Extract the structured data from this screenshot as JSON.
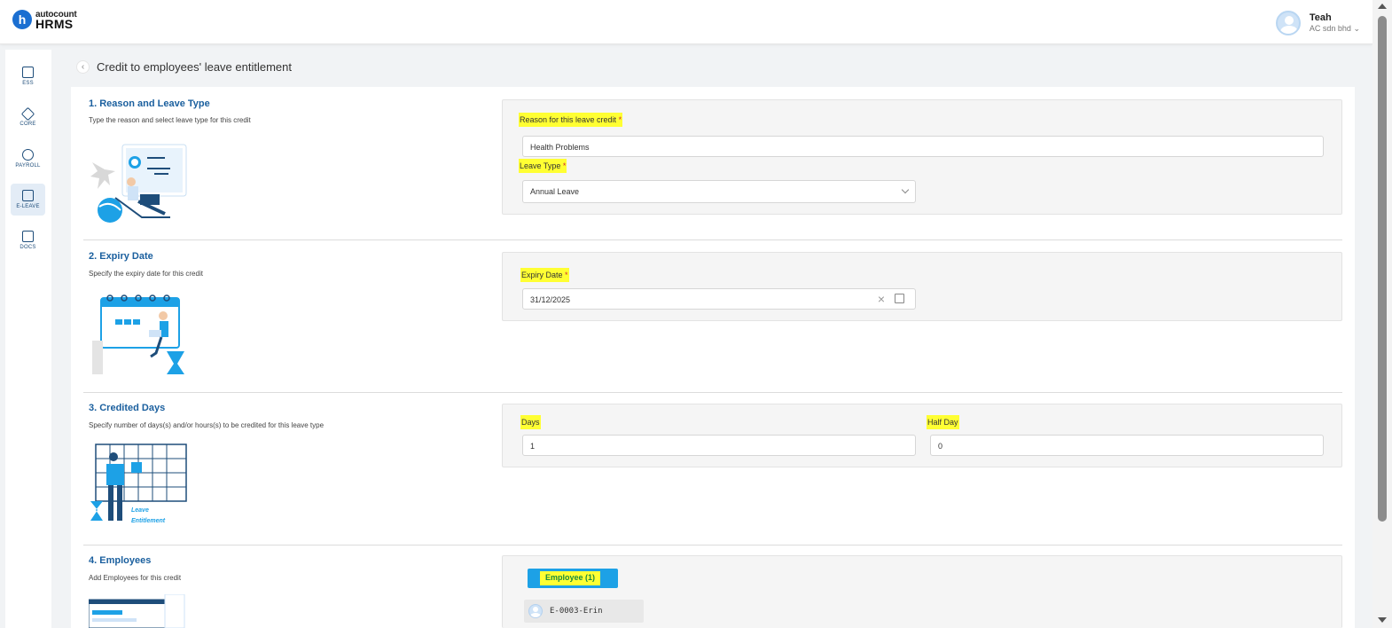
{
  "app": {
    "logo_small": "autocount",
    "logo_big": "HRMS",
    "logo_letter": "h"
  },
  "user": {
    "name": "Teah",
    "company": "AC sdn bhd"
  },
  "sidebar": {
    "items": [
      {
        "label": "ESS",
        "icon": "ess-icon"
      },
      {
        "label": "CORE",
        "icon": "core-icon"
      },
      {
        "label": "PAYROLL",
        "icon": "payroll-icon"
      },
      {
        "label": "E-LEAVE",
        "icon": "e-leave-icon",
        "active": true
      },
      {
        "label": "DOCS",
        "icon": "docs-icon"
      }
    ]
  },
  "page": {
    "title": "Credit to employees' leave entitlement"
  },
  "sections": {
    "reason": {
      "title": "1. Reason and Leave Type",
      "desc": "Type the reason and select leave type for this credit",
      "reason_label": "Reason for this leave credit",
      "reason_value": "Health Problems",
      "leave_type_label": "Leave Type",
      "leave_type_value": "Annual Leave"
    },
    "expiry": {
      "title": "2. Expiry Date",
      "desc": "Specify the expiry date for this credit",
      "expiry_label": "Expiry Date",
      "expiry_value": "31/12/2025"
    },
    "credited": {
      "title": "3. Credited Days",
      "desc": "Specify number of days(s) and/or hours(s) to be credited for this leave type",
      "days_label": "Days",
      "days_value": "1",
      "half_day_label": "Half Day",
      "half_day_value": "0",
      "illus_caption_1": "Leave",
      "illus_caption_2": "Entitlement"
    },
    "employees": {
      "title": "4. Employees",
      "desc": "Add Employees for this credit",
      "button_label": "Employee (1)",
      "employee_chip": "E-0003-Erin"
    }
  },
  "required_mark": "*",
  "colors": {
    "primary": "#1a5f9e",
    "highlight": "#ffff33",
    "accent_button": "#1da1e6",
    "required": "#d32f2f"
  }
}
